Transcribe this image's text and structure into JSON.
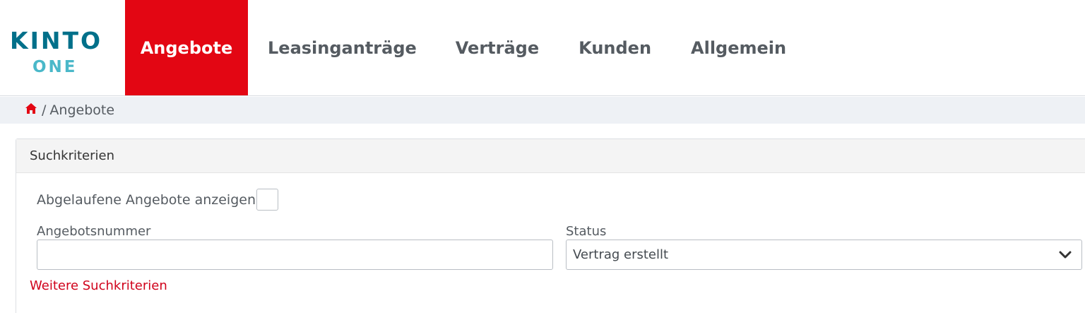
{
  "brand": {
    "logo_top": "KINTO",
    "logo_bottom": "ONE",
    "primary_color": "#00708a",
    "secondary_color": "#4ab8c9",
    "accent_color": "#e30613"
  },
  "nav": {
    "items": [
      {
        "label": "Angebote",
        "active": true
      },
      {
        "label": "Leasinganträge",
        "active": false
      },
      {
        "label": "Verträge",
        "active": false
      },
      {
        "label": "Kunden",
        "active": false
      },
      {
        "label": "Allgemein",
        "active": false
      }
    ]
  },
  "breadcrumb": {
    "icon": "home-icon",
    "separator": "/",
    "current": "Angebote"
  },
  "search": {
    "title": "Suchkriterien",
    "expired_label": "Abgelaufene Angebote anzeigen",
    "expired_checked": false,
    "offer_number_label": "Angebotsnummer",
    "offer_number_value": "",
    "status_label": "Status",
    "status_value": "Vertrag erstellt",
    "more_link": "Weitere Suchkriterien"
  }
}
